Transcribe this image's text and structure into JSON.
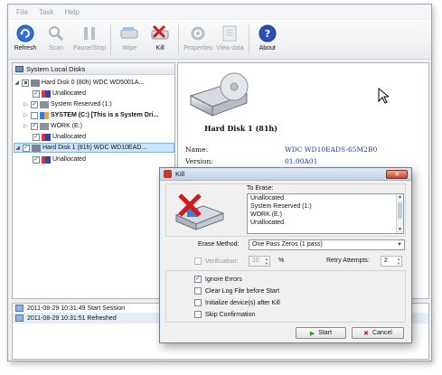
{
  "menu": [
    "File",
    "Task",
    "Help"
  ],
  "toolbar": {
    "refresh": "Refresh",
    "scan": "Scan",
    "pause_stop": "Pause/Stop",
    "wipe": "Wipe",
    "kill": "Kill",
    "properties": "Properties",
    "view_data": "View data",
    "about": "About"
  },
  "left_pane": {
    "header": "System Local Disks",
    "tree": [
      "Hard Disk 0 (80h) WDC WD5001A...",
      "Unallocated",
      "System Reserved (1:)",
      "SYSTEM (C:) [This is a System Dri...",
      "WORK (E:)",
      "Unallocated",
      "Hard Disk 1 (81h) WDC WD10EAD...",
      "Unallocated"
    ]
  },
  "details": {
    "title": "Hard Disk 1 (81h)",
    "props": [
      {
        "label": "Name:",
        "value": "WDC WD10EADS-65M2B0"
      },
      {
        "label": "Version:",
        "value": "01.00A01"
      }
    ]
  },
  "log": [
    "2011-08-29 10:31:49 Start Session",
    "2011-08-29 10:31:51 Refreshed"
  ],
  "dialog": {
    "title": "Kill",
    "to_erase_label": "To Erase:",
    "to_erase_items": [
      "Unallocated",
      "System Reserved (1:)",
      "WORK (E:)",
      "Unallocated"
    ],
    "erase_method_label": "Erase Method:",
    "erase_method_value": "One Pass Zeros (1 pass)",
    "verification_label": "Verification:",
    "verification_value": "10",
    "percent": "%",
    "retry_label": "Retry Attempts:",
    "retry_value": "2",
    "options": [
      "Ignore Errors",
      "Clear Log File before Start",
      "Initialize device(s) after Kill",
      "Skip Confirmation"
    ],
    "start": "Start",
    "cancel": "Cancel"
  }
}
